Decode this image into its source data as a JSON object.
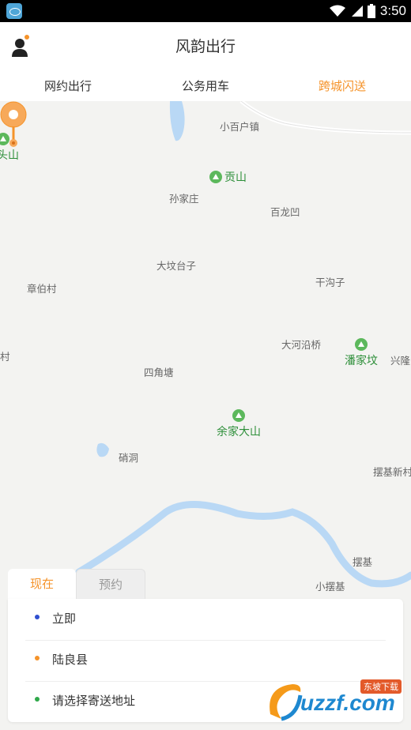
{
  "status_bar": {
    "time": "3:50"
  },
  "header": {
    "title": "风韵出行"
  },
  "tabs": [
    {
      "label": "网约出行"
    },
    {
      "label": "公务用车"
    },
    {
      "label": "跨城闪送",
      "active": true
    }
  ],
  "map": {
    "places": [
      {
        "name": "小百户镇"
      },
      {
        "name": "孙家庄"
      },
      {
        "name": "百龙凹"
      },
      {
        "name": "大坟台子"
      },
      {
        "name": "章伯村"
      },
      {
        "name": "干沟子"
      },
      {
        "name": "大河沿桥"
      },
      {
        "name": "四角塘"
      },
      {
        "name": "村"
      },
      {
        "name": "兴隆"
      },
      {
        "name": "硝洞"
      },
      {
        "name": "摆基新村"
      },
      {
        "name": "摆基"
      },
      {
        "name": "小摆基"
      }
    ],
    "pois": [
      {
        "name": "头山"
      },
      {
        "name": "贡山"
      },
      {
        "name": "潘家坟"
      },
      {
        "name": "余家大山"
      }
    ]
  },
  "panel": {
    "tabs": [
      {
        "label": "现在",
        "active": true
      },
      {
        "label": "预约"
      }
    ],
    "rows": [
      {
        "text": "立即",
        "dot_color": "#2f4fd0"
      },
      {
        "text": "陆良县",
        "dot_color": "#f5932a"
      },
      {
        "text": "请选择寄送地址",
        "dot_color": "#2fa84a"
      }
    ]
  },
  "watermark": {
    "brand": "uzzf.com",
    "sub": "东坡下载"
  },
  "colors": {
    "accent": "#f5932a",
    "poi_green": "#2e8f3a",
    "water": "#b9d8f5"
  }
}
